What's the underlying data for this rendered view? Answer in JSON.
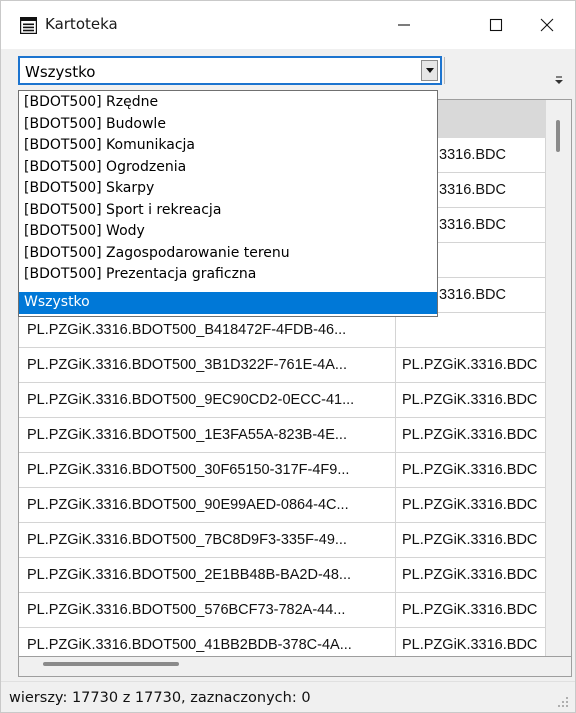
{
  "window": {
    "title": "Kartoteka"
  },
  "toolbar": {
    "filter_value": "Wszystko"
  },
  "dropdown": {
    "items": [
      "[BDOT500] Rzędne",
      "[BDOT500] Budowle",
      "[BDOT500] Komunikacja",
      "[BDOT500] Ogrodzenia",
      "[BDOT500] Skarpy",
      "[BDOT500] Sport i rekreacja",
      "[BDOT500] Wody",
      "[BDOT500] Zagospodarowanie terenu",
      "[BDOT500] Prezentacja graficzna",
      "Wszystko"
    ],
    "selected": "Wszystko"
  },
  "grid": {
    "partial_rows": [
      {
        "col2": "ZGiK.3316.BDC"
      },
      {
        "col2": "ZGiK.3316.BDC"
      },
      {
        "col2": "ZGiK.3316.BDC"
      },
      {
        "col2": ""
      },
      {
        "col2": "ZGiK.3316.BDC"
      }
    ],
    "rows": [
      {
        "col1": "PL.PZGiK.3316.BDOT500_B418472F-4FDB-46...",
        "col2": ""
      },
      {
        "col1": "PL.PZGiK.3316.BDOT500_3B1D322F-761E-4A...",
        "col2": "PL.PZGiK.3316.BDC"
      },
      {
        "col1": "PL.PZGiK.3316.BDOT500_9EC90CD2-0ECC-41...",
        "col2": "PL.PZGiK.3316.BDC"
      },
      {
        "col1": "PL.PZGiK.3316.BDOT500_1E3FA55A-823B-4E...",
        "col2": "PL.PZGiK.3316.BDC"
      },
      {
        "col1": "PL.PZGiK.3316.BDOT500_30F65150-317F-4F9...",
        "col2": "PL.PZGiK.3316.BDC"
      },
      {
        "col1": "PL.PZGiK.3316.BDOT500_90E99AED-0864-4C...",
        "col2": "PL.PZGiK.3316.BDC"
      },
      {
        "col1": "PL.PZGiK.3316.BDOT500_7BC8D9F3-335F-49...",
        "col2": "PL.PZGiK.3316.BDC"
      },
      {
        "col1": "PL.PZGiK.3316.BDOT500_2E1BB48B-BA2D-48...",
        "col2": "PL.PZGiK.3316.BDC"
      },
      {
        "col1": "PL.PZGiK.3316.BDOT500_576BCF73-782A-44...",
        "col2": "PL.PZGiK.3316.BDC"
      },
      {
        "col1": "PL.PZGiK.3316.BDOT500_41BB2BDB-378C-4A...",
        "col2": "PL.PZGiK.3316.BDC"
      }
    ]
  },
  "status": {
    "text": "wierszy: 17730 z 17730, zaznaczonych: 0"
  },
  "colors": {
    "selection": "#0078d7",
    "focus_border": "#1c74cf",
    "header": "#d9d9d9"
  }
}
